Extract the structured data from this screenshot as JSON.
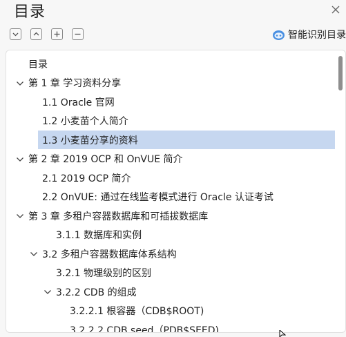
{
  "panel": {
    "title": "目录",
    "smart_toc_label": "智能识别目录"
  },
  "toolbar": {
    "buttons": [
      {
        "name": "collapse-all-button",
        "icon": "chevron-down-icon"
      },
      {
        "name": "expand-up-button",
        "icon": "chevron-up-icon"
      },
      {
        "name": "expand-all-button",
        "icon": "plus-icon"
      },
      {
        "name": "collapse-button",
        "icon": "minus-icon"
      }
    ]
  },
  "tree": {
    "items": [
      {
        "label": "目录",
        "level": 0,
        "chevron": "none"
      },
      {
        "label": "第 1 章  学习资料分享",
        "level": 0,
        "chevron": "down"
      },
      {
        "label": "1.1  Oracle 官网",
        "level": 1,
        "chevron": "none"
      },
      {
        "label": "1.2  小麦苗个人简介",
        "level": 1,
        "chevron": "none"
      },
      {
        "label": "1.3  小麦苗分享的资料",
        "level": 1,
        "chevron": "none",
        "selected": true
      },
      {
        "label": "第 2 章  2019 OCP 和 OnVUE 简介",
        "level": 0,
        "chevron": "down"
      },
      {
        "label": "2.1  2019 OCP 简介",
        "level": 1,
        "chevron": "none"
      },
      {
        "label": "2.2  OnVUE: 通过在线监考模式进行 Oracle 认证考试",
        "level": 1,
        "chevron": "none"
      },
      {
        "label": "第 3 章  多租户容器数据库和可插拔数据库",
        "level": 0,
        "chevron": "down"
      },
      {
        "label": "3.1.1  数据库和实例",
        "level": 2,
        "chevron": "none"
      },
      {
        "label": "3.2  多租户容器数据库体系结构",
        "level": 1,
        "chevron": "down"
      },
      {
        "label": "3.2.1  物理级别的区别",
        "level": 2,
        "chevron": "none"
      },
      {
        "label": "3.2.2  CDB 的组成",
        "level": 2,
        "chevron": "down"
      },
      {
        "label": "3.2.2.1  根容器（CDB$ROOT)",
        "level": 3,
        "chevron": "none"
      },
      {
        "label": "3.2.2.2  CDB seed（PDB$SEED)",
        "level": 3,
        "chevron": "none"
      }
    ]
  },
  "colors": {
    "selected_bg": "#c6d7f0",
    "background": "#f7f7f7",
    "tree_bg": "#ffffff",
    "scrollbar": "#8e8e8e"
  }
}
